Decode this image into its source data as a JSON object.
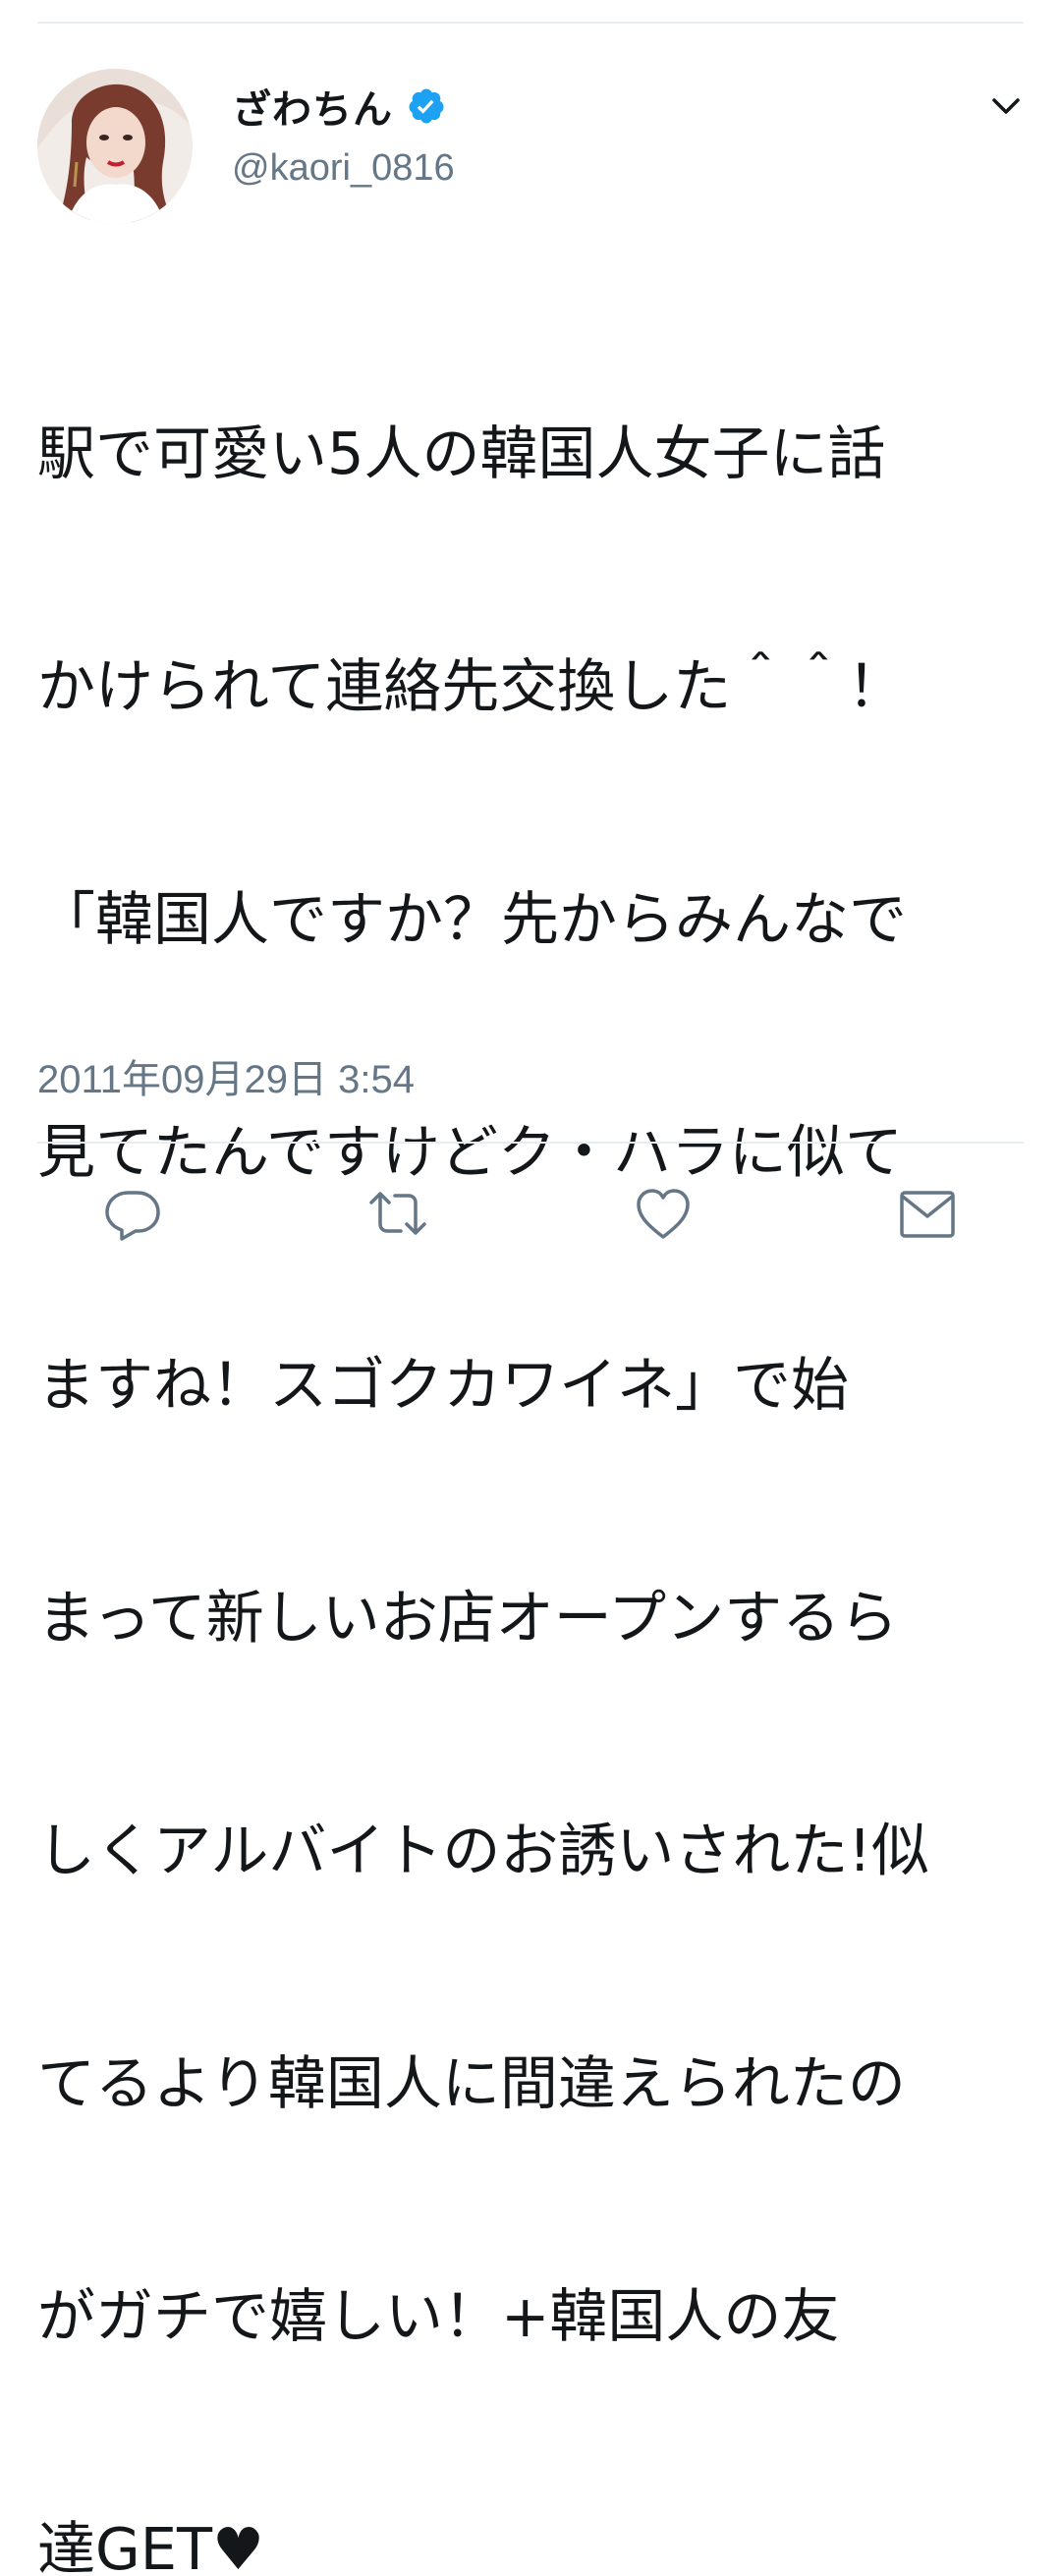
{
  "tweet": {
    "display_name": "ざわちん",
    "verified": true,
    "handle": "@kaori_0816",
    "lines": [
      "駅で可愛い5人の韓国人女子に話",
      "かけられて連絡先交換した＾＾！",
      "「韓国人ですか？先からみんなで",
      "見てたんですけどク・ハラに似て",
      "ますね！スゴクカワイネ」で始",
      "まって新しいお店オープンするら",
      "しくアルバイトのお誘いされた!似",
      "てるより韓国人に間違えられたの",
      "がガチで嬉しい！+韓国人の友",
      "達GET♥"
    ],
    "timestamp": "2011年09月29日 3:54"
  },
  "icons": {
    "avatar": "user-avatar",
    "verified": "verified-badge-icon",
    "menu": "chevron-down-icon",
    "reply": "reply-icon",
    "retweet": "retweet-icon",
    "like": "heart-icon",
    "dm": "envelope-icon"
  },
  "colors": {
    "text": "#14171a",
    "secondary": "#657786",
    "verified": "#1da1f2",
    "divider": "#e6ecf0"
  }
}
